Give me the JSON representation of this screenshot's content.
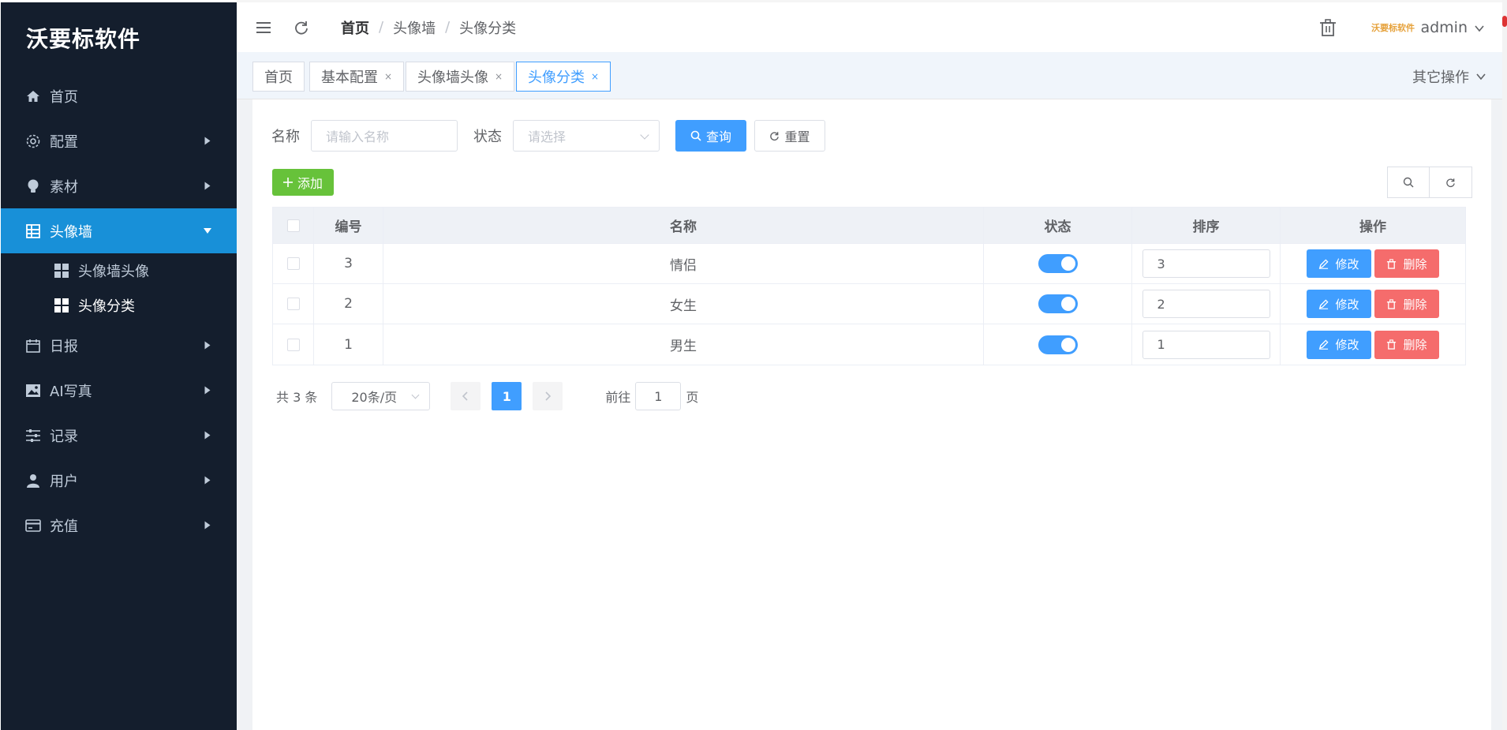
{
  "brand": "沃要标软件",
  "sidebar": {
    "items": [
      {
        "label": "首页"
      },
      {
        "label": "配置"
      },
      {
        "label": "素材"
      },
      {
        "label": "头像墙"
      },
      {
        "label": "日报"
      },
      {
        "label": "AI写真"
      },
      {
        "label": "记录"
      },
      {
        "label": "用户"
      },
      {
        "label": "充值"
      }
    ],
    "sub_items": [
      {
        "label": "头像墙头像"
      },
      {
        "label": "头像分类"
      }
    ]
  },
  "header": {
    "breadcrumb": [
      "首页",
      "头像墙",
      "头像分类"
    ],
    "avatar_text": "沃要标软件",
    "username": "admin"
  },
  "tags": {
    "items": [
      {
        "label": "首页"
      },
      {
        "label": "基本配置"
      },
      {
        "label": "头像墙头像"
      },
      {
        "label": "头像分类"
      }
    ],
    "close": "×",
    "other_ops": "其它操作"
  },
  "search": {
    "name_label": "名称",
    "name_placeholder": "请输入名称",
    "status_label": "状态",
    "status_placeholder": "请选择",
    "query_label": "查询",
    "reset_label": "重置"
  },
  "toolbar": {
    "add_label": "添加"
  },
  "table": {
    "headers": [
      "编号",
      "名称",
      "状态",
      "排序",
      "操作"
    ],
    "rows": [
      {
        "id": "3",
        "name": "情侣",
        "status": true,
        "sort": "3"
      },
      {
        "id": "2",
        "name": "女生",
        "status": true,
        "sort": "2"
      },
      {
        "id": "1",
        "name": "男生",
        "status": true,
        "sort": "1"
      }
    ],
    "edit_label": "修改",
    "delete_label": "删除"
  },
  "pagination": {
    "total": "共 3 条",
    "page_size": "20条/页",
    "current": "1",
    "goto_prefix": "前往",
    "goto_value": "1",
    "goto_suffix": "页"
  },
  "colors": {
    "sidebar_bg": "#141e2d",
    "active_menu": "#1890d8",
    "primary": "#409eff",
    "success": "#67c23a",
    "danger": "#f56c6c"
  }
}
